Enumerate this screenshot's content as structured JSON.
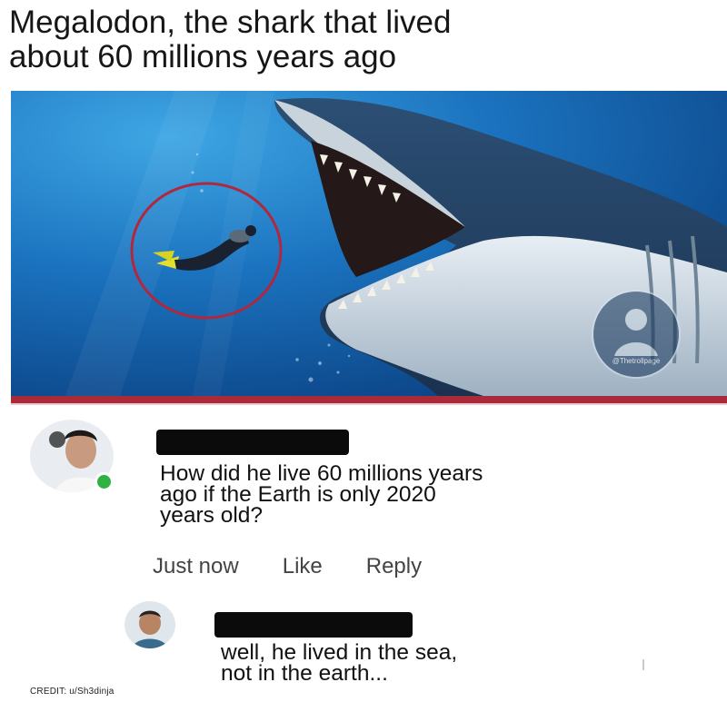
{
  "post": {
    "headline_line1": "Megalodon, the shark that lived",
    "headline_line2": "about 60 millions years ago",
    "watermark": "@Thetrollpage"
  },
  "comments": [
    {
      "text_line1": "How did he live 60 millions years",
      "text_line2": "ago if the Earth is only 2020",
      "text_line3": "years old?",
      "time": "Just now",
      "like_label": "Like",
      "reply_label": "Reply"
    },
    {
      "text_line1": "well, he lived in the sea,",
      "text_line2": "not in the earth..."
    }
  ],
  "credit": "CREDIT: u/Sh3dinja",
  "colors": {
    "divider": "#ab2a3a",
    "highlight_circle": "#b0283e",
    "online": "#2fb143"
  }
}
